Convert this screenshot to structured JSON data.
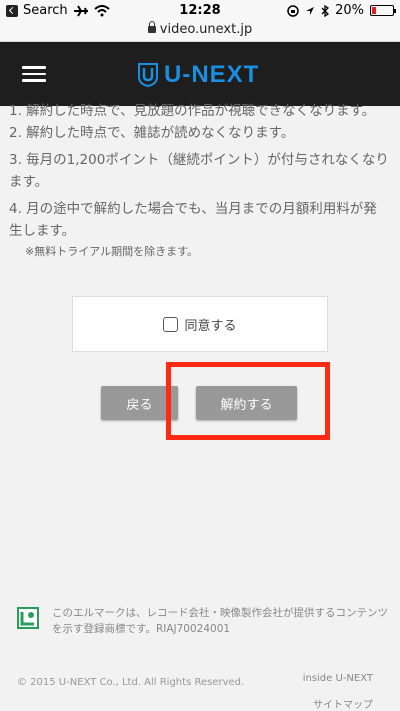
{
  "status_bar": {
    "back_app": "Search",
    "time": "12:28",
    "battery": "20%",
    "battery_level": 0.2
  },
  "url_bar": {
    "url": "video.unext.jp"
  },
  "header": {
    "logo_text": "U-NEXT"
  },
  "content": {
    "item1": "1. 解約した時点で、見放題の作品が視聴できなくなります。",
    "item2": "2. 解約した時点で、雑誌が読めなくなります。",
    "item3": "3. 毎月の1,200ポイント（継続ポイント）が付与されなくなります。",
    "item4": "4. 月の途中で解約した場合でも、当月までの月額利用料が発生します。",
    "note": "※無料トライアル期間を除きます。"
  },
  "agree": {
    "label": "同意する",
    "checked": false
  },
  "buttons": {
    "back": "戻る",
    "cancel_membership": "解約する"
  },
  "highlight_color": "#ff2a14",
  "riaj": {
    "text": "このエルマークは、レコード会社・映像製作会社が提供するコンテンツを示す登録商標です。RIAJ70024001"
  },
  "footer": {
    "copyright": "© 2015 U-NEXT Co., Ltd. All Rights Reserved.",
    "link_inside": "inside U-NEXT",
    "link_sitemap": "サイトマップ"
  },
  "colors": {
    "accent": "#1a8ee0",
    "header_bg": "#1e1e1e",
    "button_bg": "#999999"
  }
}
